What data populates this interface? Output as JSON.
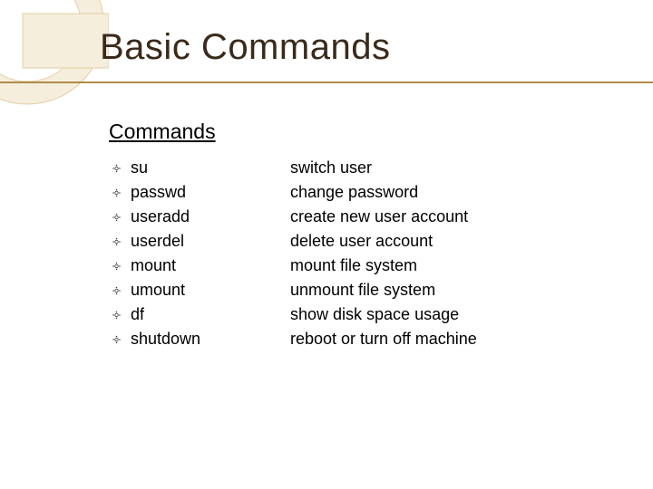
{
  "slide": {
    "title": "Basic Commands",
    "subtitle": "Commands",
    "bullet_glyph": "༓",
    "items": [
      {
        "cmd": "su",
        "desc": "switch user"
      },
      {
        "cmd": "passwd",
        "desc": "change password"
      },
      {
        "cmd": "useradd",
        "desc": "create new user account"
      },
      {
        "cmd": "userdel",
        "desc": "delete user account"
      },
      {
        "cmd": "mount",
        "desc": "mount file system"
      },
      {
        "cmd": "umount",
        "desc": "unmount file system"
      },
      {
        "cmd": "df",
        "desc": "show disk space usage"
      },
      {
        "cmd": "shutdown",
        "desc": "reboot or turn off machine"
      }
    ]
  },
  "colors": {
    "accent": "#b08a4a",
    "decoration_fill": "#f6eedc",
    "decoration_stroke": "#e2cfa3"
  }
}
